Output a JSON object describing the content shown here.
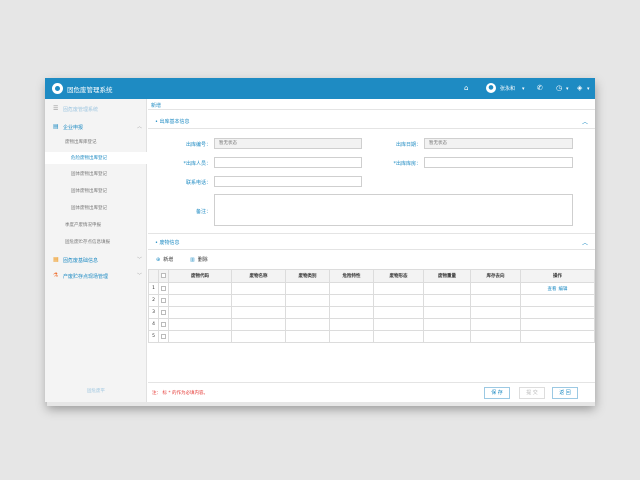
{
  "header": {
    "app_title": "固危废管理系统",
    "username": "张永和",
    "icons": [
      "home-icon",
      "user-icon",
      "caret-down-icon",
      "phone-icon",
      "help-icon",
      "layers-icon"
    ]
  },
  "sidebar": {
    "system_title": "固危废管理系统",
    "items": [
      {
        "label": "企业申报",
        "icon": "document-icon",
        "expanded": true
      },
      {
        "label": "固危废基础信息",
        "icon": "database-icon",
        "expanded": false
      },
      {
        "label": "产废贮存点现场管理",
        "icon": "flask-icon",
        "expanded": false
      }
    ],
    "sub_items": [
      "废物出库库登记",
      "危险废物出库登记",
      "固体废物出库登记",
      "固体废物出库登记",
      "固体废物出库登记",
      "季度产废情况申报",
      "固危废贮存点信息填报"
    ],
    "footer": "固危废平"
  },
  "breadcrumb": "新增",
  "section1": {
    "title": "• 出库基本信息",
    "fields": {
      "out_no_label": "出库编号：",
      "out_no_value": "暂无状态",
      "out_date_label": "出库日期：",
      "out_date_value": "暂无状态",
      "person_label": "*出库人员：",
      "warehouse_label": "*出库库房：",
      "phone_label": "联系电话：",
      "remark_label": "备注："
    }
  },
  "section2": {
    "title": "• 废物信息",
    "add_label": "新增",
    "delete_label": "删除"
  },
  "table": {
    "columns": [
      "废物代码",
      "废物名称",
      "废物类别",
      "危险特性",
      "废物形态",
      "废物重量",
      "库存去向",
      "操作"
    ],
    "rows": [
      "1",
      "2",
      "3",
      "4",
      "5"
    ],
    "view_label": "查看",
    "edit_label": "编辑"
  },
  "footer": {
    "note": "注：    标 * 的作为必填内容。",
    "save": "保 存",
    "submit": "提 交",
    "back": "返 回"
  },
  "colors": {
    "primary": "#1e8bc3",
    "required_note": "#e53935"
  }
}
